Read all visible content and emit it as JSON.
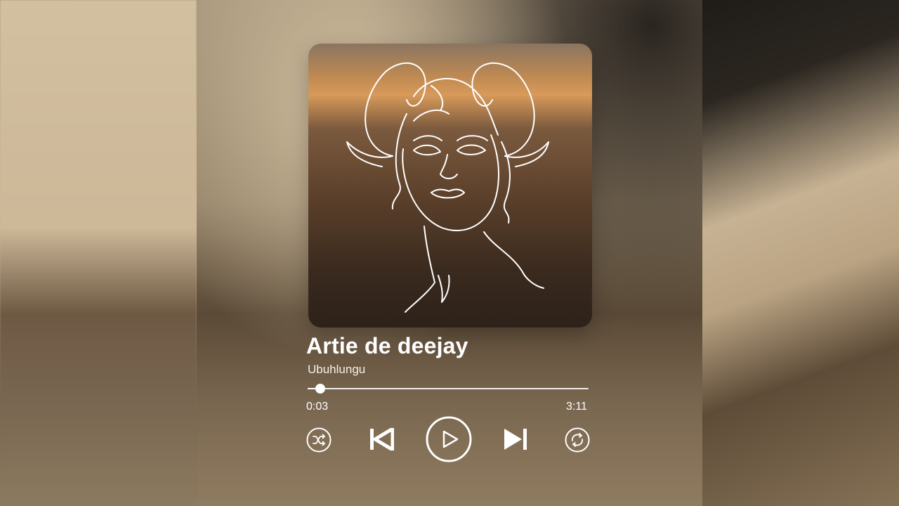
{
  "track": {
    "title": "Artie de deejay",
    "artist": "Ubuhlungu"
  },
  "progress": {
    "elapsed": "0:03",
    "duration": "3:11",
    "fraction": 0.045
  },
  "controls": {
    "shuffle_icon": "shuffle-icon",
    "previous_icon": "skip-previous-icon",
    "play_icon": "play-icon",
    "next_icon": "skip-next-icon",
    "repeat_icon": "repeat-icon"
  },
  "colors": {
    "foreground": "#ffffff"
  }
}
